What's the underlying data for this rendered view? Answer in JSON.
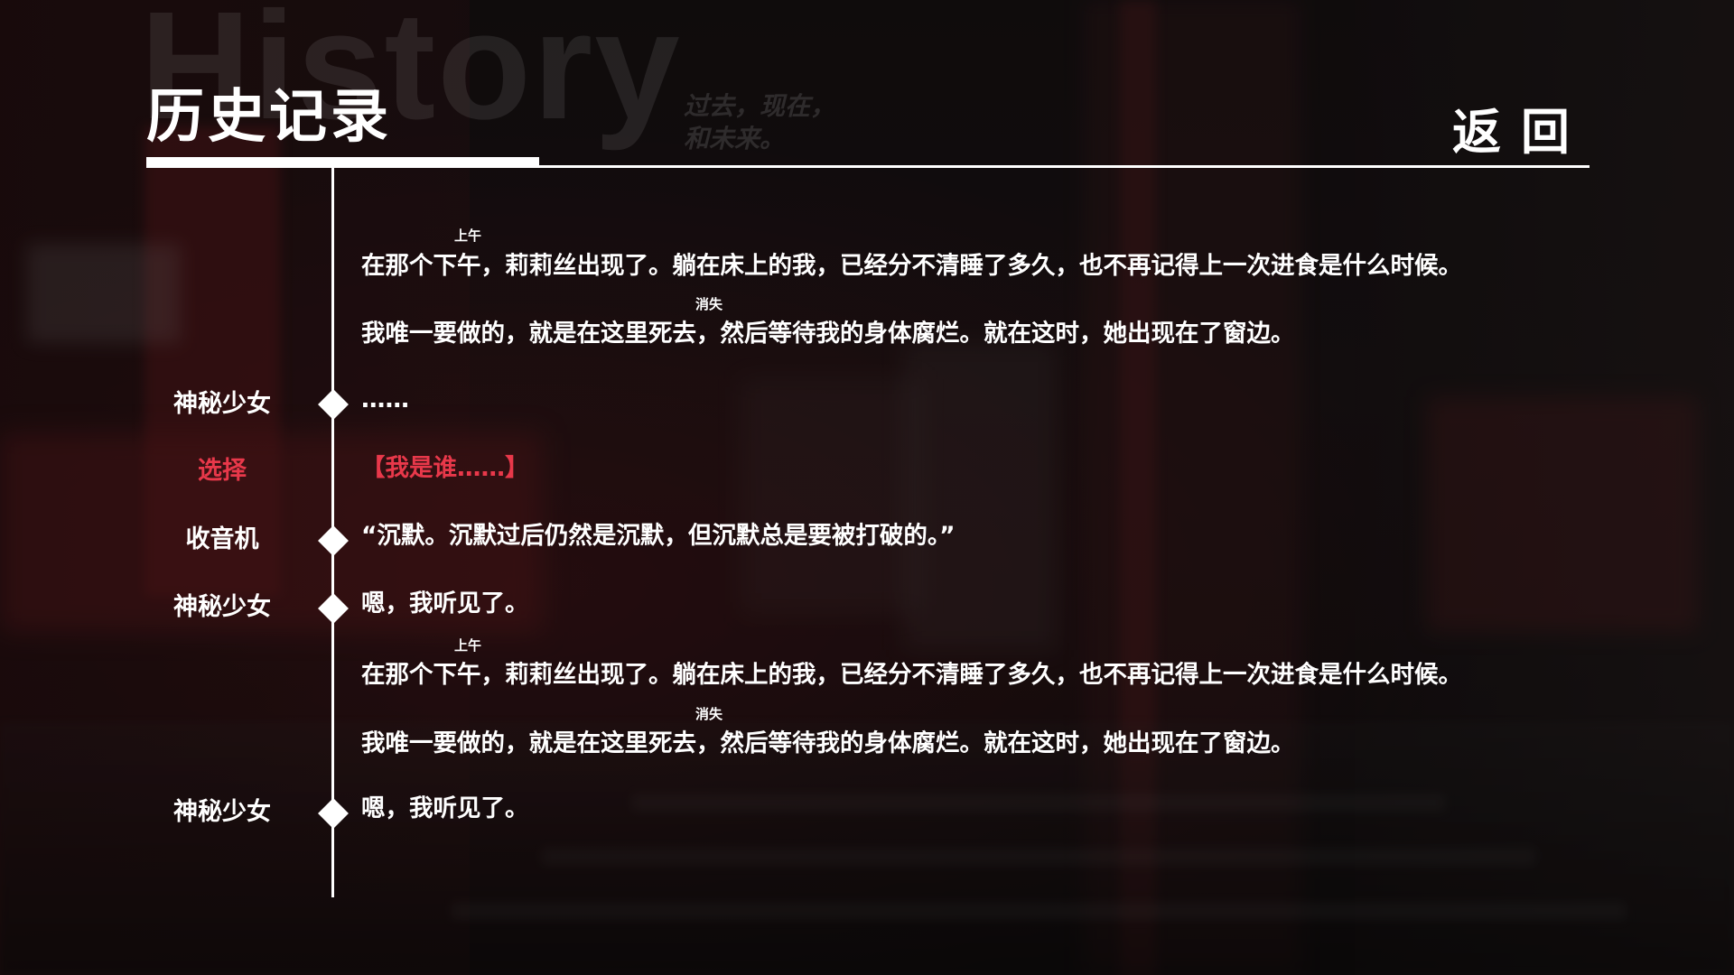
{
  "header": {
    "watermark": "History",
    "watermark_sub_line1": "过去，现在，",
    "watermark_sub_line2": "和未来。",
    "title": "历史记录",
    "back_label": "返回"
  },
  "entries": [
    {
      "speaker": "",
      "lines": [
        {
          "text": "在那个下午，莉莉丝出现了。躺在床上的我，已经分不清睡了多久，也不再记得上一次进食是什么时候。",
          "ruby": "上午"
        },
        {
          "text": "我唯一要做的，就是在这里死去，然后等待我的身体腐烂。就在这时，她出现在了窗边。",
          "ruby": "消失"
        }
      ]
    },
    {
      "speaker": "神秘少女",
      "text": "……"
    },
    {
      "speaker": "选择",
      "text": "【我是谁……】",
      "type": "choice"
    },
    {
      "speaker": "收音机",
      "text": "“沉默。沉默过后仍然是沉默，但沉默总是要被打破的。”"
    },
    {
      "speaker": "神秘少女",
      "text": "嗯，我听见了。"
    },
    {
      "speaker": "",
      "lines": [
        {
          "text": "在那个下午，莉莉丝出现了。躺在床上的我，已经分不清睡了多久，也不再记得上一次进食是什么时候。",
          "ruby": "上午"
        },
        {
          "text": "我唯一要做的，就是在这里死去，然后等待我的身体腐烂。就在这时，她出现在了窗边。",
          "ruby": "消失"
        }
      ]
    },
    {
      "speaker": "神秘少女",
      "text": "嗯，我听见了。"
    }
  ],
  "colors": {
    "choice": "#e8384a",
    "text": "#ffffff",
    "background": "#0c0a0b"
  }
}
